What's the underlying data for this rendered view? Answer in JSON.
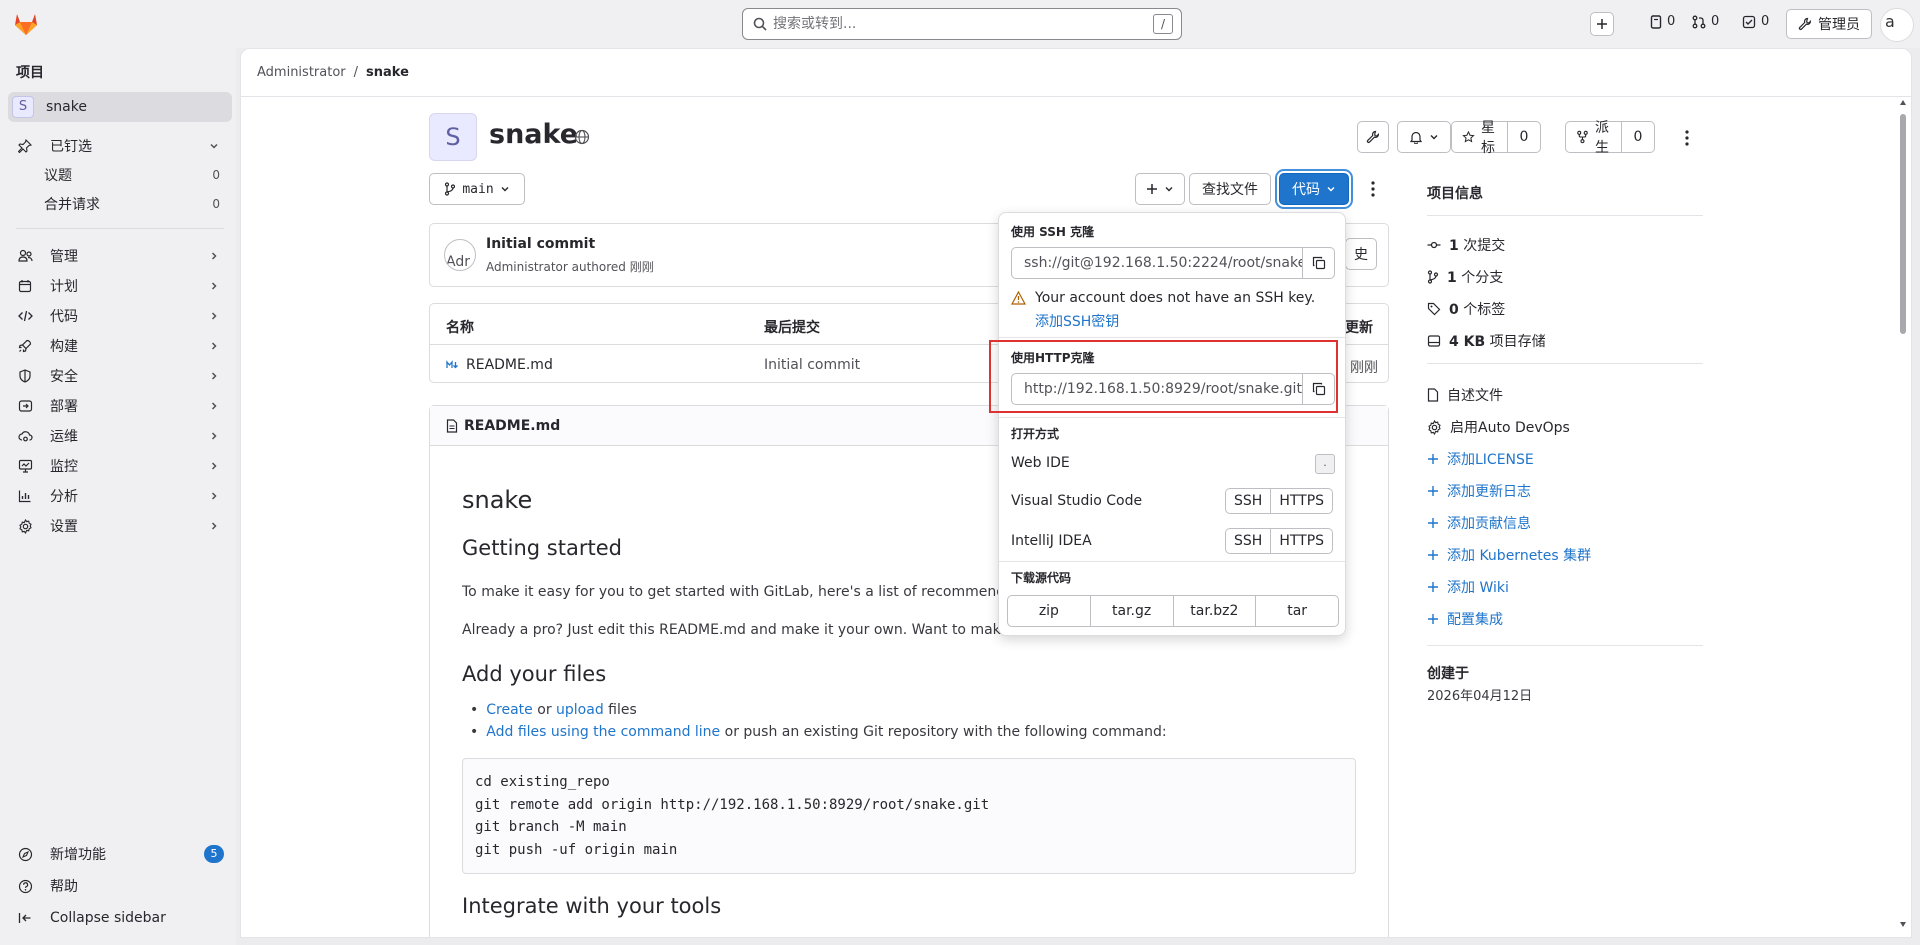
{
  "topbar": {
    "search_placeholder": "搜索或转到...",
    "search_shortcut": "/",
    "issues_count": "0",
    "mr_count": "0",
    "todo_count": "0",
    "admin_label": "管理员",
    "avatar_text": "a"
  },
  "sidebar": {
    "heading": "项目",
    "project": {
      "initial": "S",
      "name": "snake"
    },
    "pinned": "已钉选",
    "pinned_items": [
      {
        "label": "议题",
        "count": "0"
      },
      {
        "label": "合并请求",
        "count": "0"
      }
    ],
    "nav": [
      "管理",
      "计划",
      "代码",
      "构建",
      "安全",
      "部署",
      "运维",
      "监控",
      "分析",
      "设置"
    ],
    "whats_new": "新增功能",
    "whats_new_count": "5",
    "help": "帮助",
    "collapse": "Collapse sidebar"
  },
  "breadcrumb": {
    "parent": "Administrator",
    "sep": "/",
    "current": "snake"
  },
  "project": {
    "initial": "S",
    "name": "snake",
    "star_label": "星标",
    "star_count": "0",
    "fork_label": "派生",
    "fork_count": "0",
    "branch": "main",
    "find_file": "查找文件",
    "code_button": "代码"
  },
  "commit": {
    "title": "Initial commit",
    "meta": "Administrator authored 刚刚",
    "avatar_text": "Adr",
    "history_fragment": "史"
  },
  "file_table": {
    "headers": [
      "名称",
      "最后提交",
      "最后更新"
    ],
    "header_fragment": "更新",
    "rows": [
      {
        "name": "README.md",
        "commit": "Initial commit",
        "updated_fragment": "刚刚"
      }
    ]
  },
  "readme": {
    "filename": "README.md",
    "h1": "snake",
    "h2_getting_started": "Getting started",
    "p1": "To make it easy for you to get started with GitLab, here's a list of recommended n",
    "p2": "Already a pro? Just edit this README.md and make it your own. Want to make it e",
    "h2_add_files": "Add your files",
    "bullet1_link1": "Create",
    "bullet1_or": " or ",
    "bullet1_link2": "upload",
    "bullet1_rest": " files",
    "bullet2_link": "Add files using the command line",
    "bullet2_rest": " or push an existing Git repository with the following command:",
    "code": "cd existing_repo\ngit remote add origin http://192.168.1.50:8929/root/snake.git\ngit branch -M main\ngit push -uf origin main",
    "h2_integrate": "Integrate with your tools"
  },
  "dropdown": {
    "ssh_head": "使用 SSH 克隆",
    "ssh_url": "ssh://git@192.168.1.50:2224/root/snake.git",
    "ssh_warning": "Your account does not have an SSH key.",
    "add_ssh_key": "添加SSH密钥",
    "http_head": "使用HTTP克隆",
    "http_url": "http://192.168.1.50:8929/root/snake.git",
    "open_head": "打开方式",
    "web_ide": "Web IDE",
    "web_ide_key": ".",
    "vscode": "Visual Studio Code",
    "intellij": "IntelliJ IDEA",
    "ssh_btn": "SSH",
    "https_btn": "HTTPS",
    "download_head": "下载源代码",
    "downloads": [
      "zip",
      "tar.gz",
      "tar.bz2",
      "tar"
    ]
  },
  "project_info": {
    "heading": "项目信息",
    "commits_num": "1",
    "commits_label": "次提交",
    "branches_num": "1",
    "branches_label": "个分支",
    "tags_num": "0",
    "tags_label": "个标签",
    "storage_num": "4 KB",
    "storage_label": "项目存储",
    "readme": "自述文件",
    "devops": "启用Auto DevOps",
    "links": [
      "添加LICENSE",
      "添加更新日志",
      "添加贡献信息",
      "添加 Kubernetes 集群",
      "添加 Wiki",
      "配置集成"
    ],
    "created_head": "创建于",
    "created_date": "2026年04月12日"
  },
  "colors": {
    "accent": "#1f75cb",
    "highlight": "#e03131",
    "brand_orange": "#e24329"
  }
}
